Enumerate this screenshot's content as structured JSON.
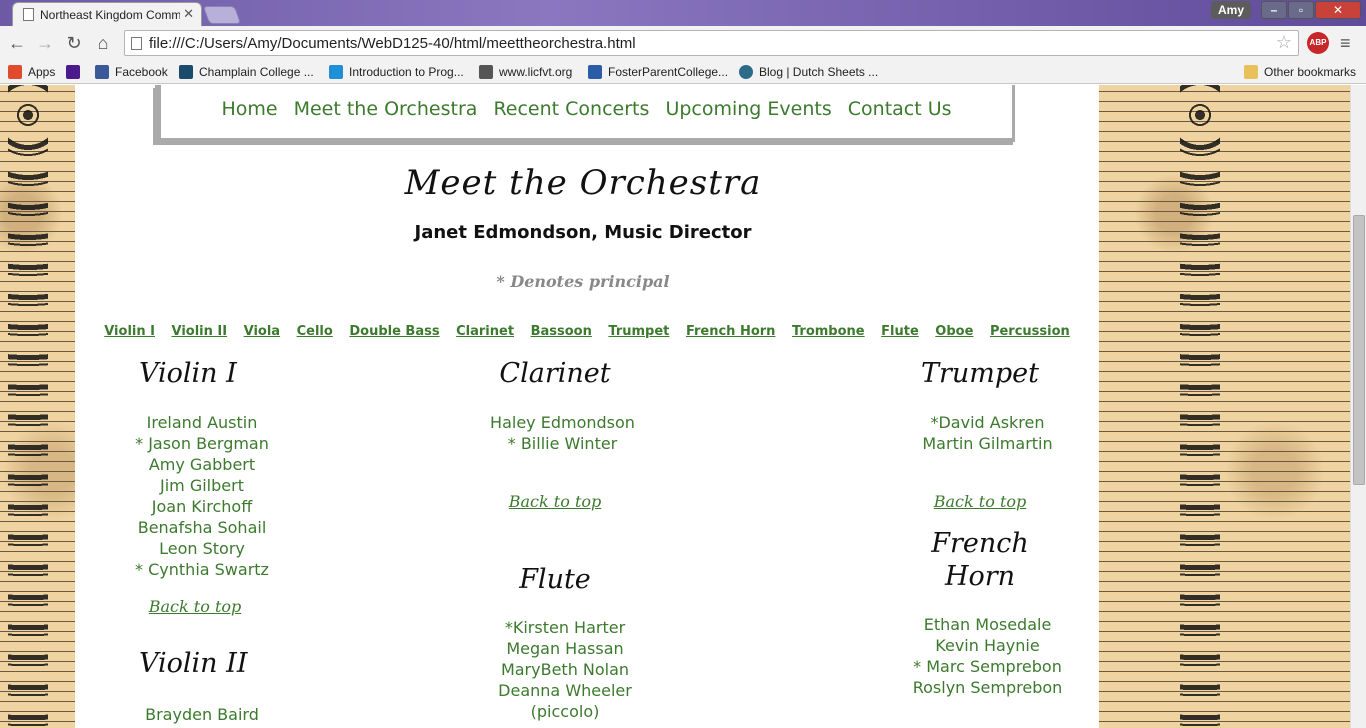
{
  "browser": {
    "tab_title": "Northeast Kingdom Comm",
    "tab_close": "✕",
    "url": "file:///C:/Users/Amy/Documents/WebD125-40/html/meettheorchestra.html",
    "user": "Amy",
    "abp_label": "ABP",
    "bookmarks": [
      {
        "label": "Apps",
        "color": "#e04b2e"
      },
      {
        "label": "",
        "color": "#4b1a8c"
      },
      {
        "label": "Facebook",
        "color": "#3b5998"
      },
      {
        "label": "Champlain College ...",
        "color": "#1b4b6b"
      },
      {
        "label": "Introduction to Prog...",
        "color": "#1f8fd6"
      },
      {
        "label": "www.licfvt.org",
        "color": "#555555"
      },
      {
        "label": "FosterParentCollege...",
        "color": "#2a5ca8"
      },
      {
        "label": "Blog | Dutch Sheets ...",
        "color": "#2d6b8a"
      }
    ],
    "other_bookmarks": "Other bookmarks"
  },
  "nav": {
    "links": [
      "Home",
      "Meet the Orchestra",
      "Recent Concerts",
      "Upcoming Events",
      "Contact Us"
    ]
  },
  "page": {
    "title": "Meet the Orchestra",
    "director": "Janet Edmondson, Music Director",
    "principal_note": "* Denotes principal",
    "back_to_top": "Back to top"
  },
  "section_links": [
    "Violin I",
    "Violin II",
    "Viola",
    "Cello",
    "Double Bass",
    "Clarinet",
    "Bassoon",
    "Trumpet",
    "French Horn",
    "Trombone",
    "Flute",
    "Oboe",
    "Percussion"
  ],
  "sections": {
    "violin1": {
      "title": "Violin I",
      "members": [
        "Ireland Austin",
        "* Jason Bergman",
        "Amy Gabbert",
        "Jim Gilbert",
        "Joan Kirchoff",
        "Benafsha Sohail",
        "Leon Story",
        "* Cynthia Swartz"
      ]
    },
    "violin2": {
      "title": "Violin II",
      "members": [
        "Brayden Baird"
      ]
    },
    "clarinet": {
      "title": "Clarinet",
      "members": [
        "Haley Edmondson",
        "* Billie Winter"
      ]
    },
    "flute": {
      "title": "Flute",
      "members": [
        "*Kirsten Harter",
        "Megan Hassan",
        "MaryBeth Nolan",
        "Deanna Wheeler",
        "(piccolo)"
      ]
    },
    "trumpet": {
      "title": "Trumpet",
      "members": [
        "*David Askren",
        "Martin Gilmartin"
      ]
    },
    "frenchhorn": {
      "title_line1": "French",
      "title_line2": "Horn",
      "members": [
        "Ethan Mosedale",
        "Kevin Haynie",
        "* Marc Semprebon",
        "Roslyn Semprebon"
      ]
    }
  }
}
